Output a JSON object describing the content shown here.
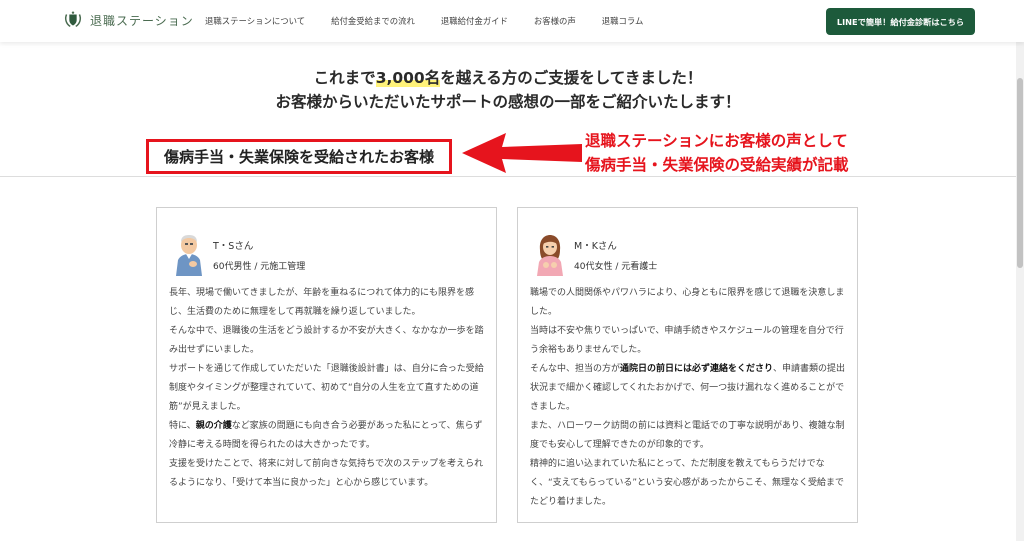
{
  "header": {
    "logo_text": "退職ステーション",
    "nav": [
      "退職ステーションについて",
      "給付金受給までの流れ",
      "退職給付金ガイド",
      "お客様の声",
      "退職コラム"
    ],
    "cta_label": "LINEで簡単！給付金診断はこちら"
  },
  "intro": {
    "line1_before": "これまで",
    "line1_highlight": "3,000名",
    "line1_after": "を越える方のご支援をしてきました！",
    "line2": "お客様からいただいたサポートの感想の一部をご紹介いたします！"
  },
  "section_heading": "傷病手当・失業保険を受給されたお客様",
  "annotation": {
    "line1": "退職ステーションにお客様の声として",
    "line2": "傷病手当・失業保険の受給実績が記載"
  },
  "colors": {
    "brand_green": "#1d5a3b",
    "annotation_red": "#e6141d",
    "highlight_yellow": "#fff27a"
  },
  "testimonials": [
    {
      "name": "T・Sさん",
      "meta": "60代男性 / 元施工管理",
      "avatar_icon": "elderly-man-icon",
      "paragraphs": [
        {
          "text": "長年、現場で働いてきましたが、年齢を重ねるにつれて体力的にも限界を感じ、生活費のために無理をして再就職を繰り返していました。"
        },
        {
          "text": "そんな中で、退職後の生活をどう設計するか不安が大きく、なかなか一歩を踏み出せずにいました。"
        },
        {
          "text": "サポートを通じて作成していただいた「退職後設計書」は、自分に合った受給制度やタイミングが整理されていて、初めて“自分の人生を立て直すための道筋”が見えました。"
        },
        {
          "before": "特に、",
          "bold": "親の介護",
          "after": "など家族の問題にも向き合う必要があった私にとって、焦らず冷静に考える時間を得られたのは大きかったです。"
        },
        {
          "text": "支援を受けたことで、将来に対して前向きな気持ちで次のステップを考えられるようになり、「受けて本当に良かった」と心から感じています。"
        }
      ]
    },
    {
      "name": "M・Kさん",
      "meta": "40代女性 / 元看護士",
      "avatar_icon": "woman-icon",
      "paragraphs": [
        {
          "text": "職場での人間関係やパワハラにより、心身ともに限界を感じて退職を決意しました。"
        },
        {
          "text": "当時は不安や焦りでいっぱいで、申請手続きやスケジュールの管理を自分で行う余裕もありませんでした。"
        },
        {
          "before": "そんな中、担当の方が",
          "bold": "通院日の前日には必ず連絡をくださり",
          "after": "、申請書類の提出状況まで細かく確認してくれたおかげで、何一つ抜け漏れなく進めることができました。"
        },
        {
          "text": "また、ハローワーク訪問の前には資料と電話での丁寧な説明があり、複雑な制度でも安心して理解できたのが印象的です。"
        },
        {
          "text": "精神的に追い込まれていた私にとって、ただ制度を教えてもらうだけでなく、“支えてもらっている”という安心感があったからこそ、無理なく受給までたどり着けました。"
        }
      ]
    }
  ]
}
